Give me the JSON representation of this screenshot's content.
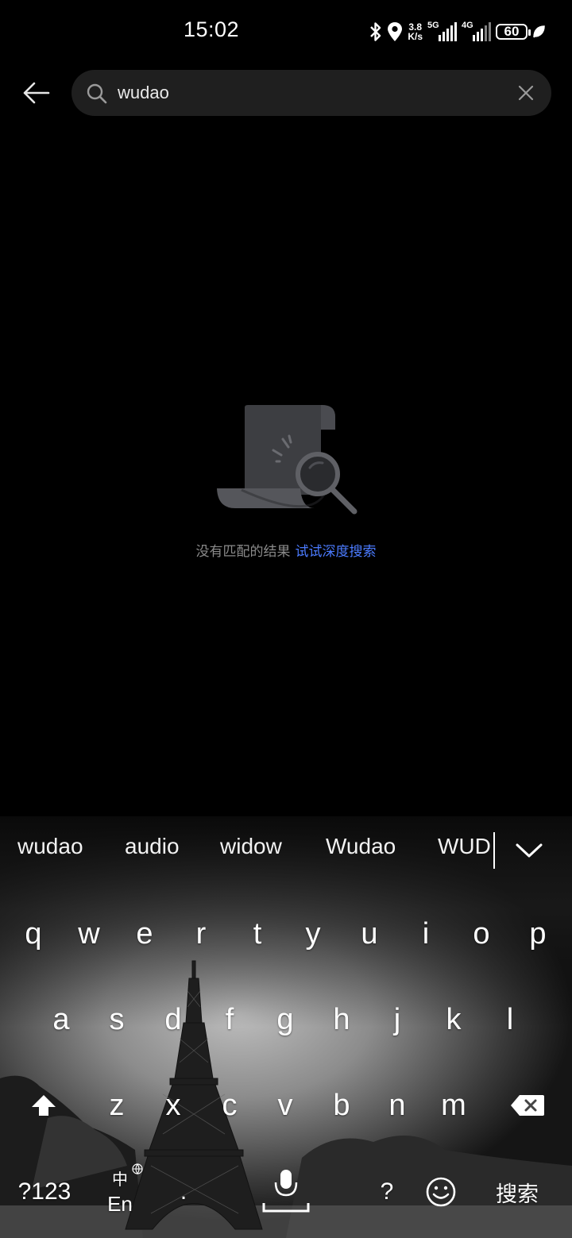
{
  "status_bar": {
    "time": "15:02",
    "net_speed_value": "3.8",
    "net_speed_unit": "K/s",
    "sim1_label": "5G",
    "sim2_label": "4G",
    "battery": "60",
    "icons": [
      "bluetooth-icon",
      "location-icon",
      "leaf-icon"
    ]
  },
  "search": {
    "query": "wudao",
    "placeholder": ""
  },
  "empty_state": {
    "message": "没有匹配的结果",
    "action_link": "试试深度搜索"
  },
  "keyboard": {
    "suggestions": [
      "wudao",
      "audio",
      "widow",
      "Wudao",
      "WUD"
    ],
    "row1": [
      "q",
      "w",
      "e",
      "r",
      "t",
      "y",
      "u",
      "i",
      "o",
      "p"
    ],
    "row2": [
      "a",
      "s",
      "d",
      "f",
      "g",
      "h",
      "j",
      "k",
      "l"
    ],
    "row3": [
      "z",
      "x",
      "c",
      "v",
      "b",
      "n",
      "m"
    ],
    "symbols_key": "?123",
    "lang_key_top": "中",
    "lang_key_bottom": "En",
    "period_key": ".",
    "question_key": "?",
    "search_key": "搜索"
  },
  "colors": {
    "background": "#000000",
    "search_bg": "#1f1f1f",
    "link": "#4b7bff",
    "muted": "#8a8a8a"
  }
}
